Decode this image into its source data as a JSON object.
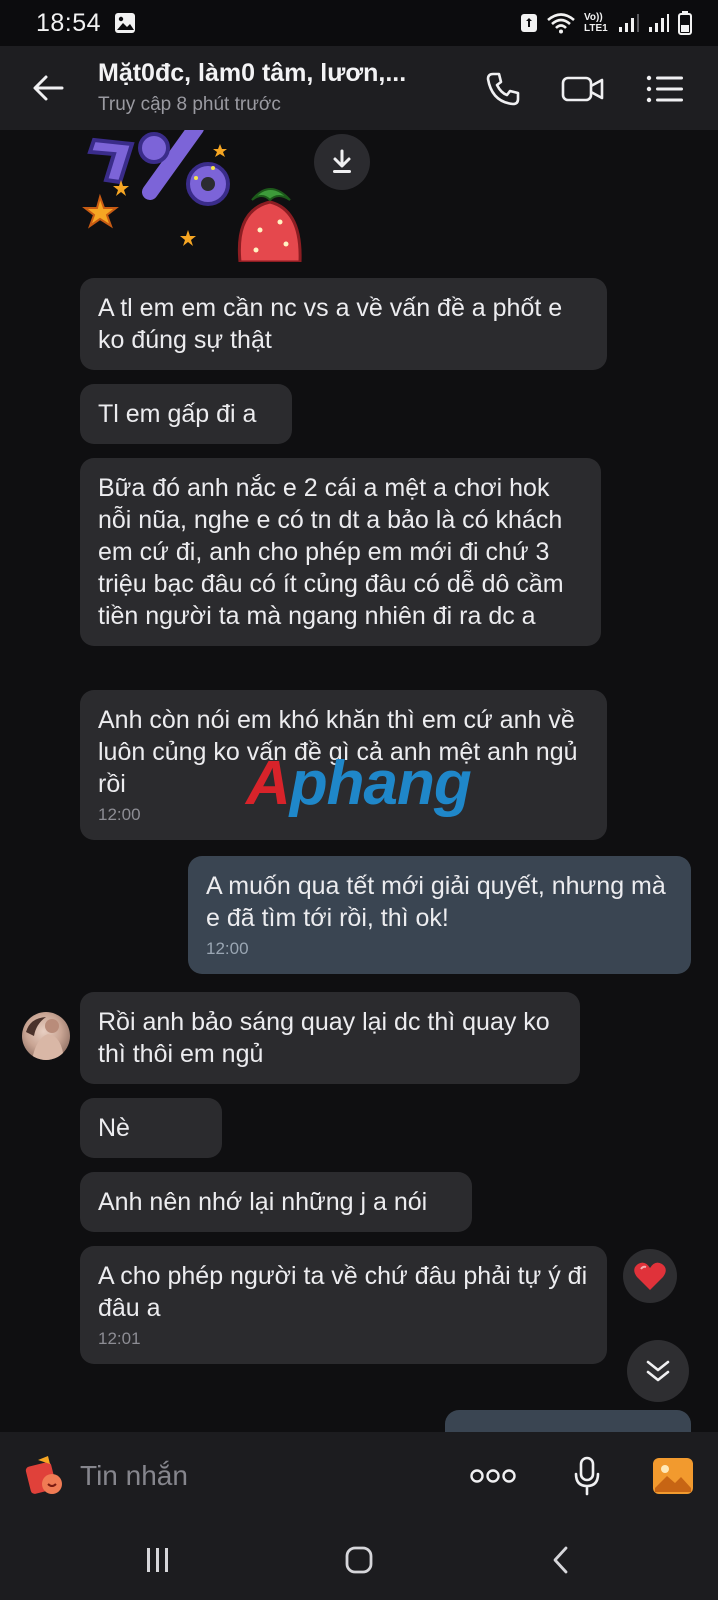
{
  "status_bar": {
    "time": "18:54",
    "network_label": "Vo)) LTE1"
  },
  "header": {
    "title": "Mặt0đc, làm0 tâm, lươn,...",
    "subtitle": "Truy cập 8 phút trước"
  },
  "messages": [
    {
      "text": "A tl em em cần nc vs a về vấn đề a phốt e ko đúng sự thật",
      "time": ""
    },
    {
      "text": "Tl em gấp đi a",
      "time": ""
    },
    {
      "text": "Bữa đó anh nắc e 2 cái a mệt a chơi hok nỗi nũa, nghe e có tn dt a bảo là có khách em cứ đi, anh cho phép em mới đi chứ 3 triệu bạc đâu có ít củng đâu có dễ dô cầm tiền người ta mà ngang nhiên đi ra dc a",
      "time": ""
    },
    {
      "text": "Anh còn nói em khó khăn thì em cứ anh về luôn củng ko vấn đề gì cả anh mệt anh ngủ rồi",
      "time": "12:00"
    },
    {
      "text": "A muốn qua tết mới giải quyết, nhưng mà e đã tìm tới rồi, thì ok!",
      "time": "12:00"
    },
    {
      "text": "Rồi anh bảo sáng quay lại dc thì quay ko thì thôi em ngủ",
      "time": ""
    },
    {
      "text": "Nè",
      "time": ""
    },
    {
      "text": "Anh nên nhớ lại những j a nói",
      "time": ""
    },
    {
      "text": "A cho phép người ta về chứ đâu phải tự ý đi đâu a",
      "time": "12:01"
    }
  ],
  "watermark": {
    "part1": "A",
    "part2": "phang"
  },
  "composer": {
    "placeholder": "Tin nhắn"
  },
  "colors": {
    "incoming": "#2b2b2e",
    "outgoing": "#3a4552",
    "background": "#0f0f11",
    "header": "#1e1e21",
    "reaction": "#e0323a"
  }
}
